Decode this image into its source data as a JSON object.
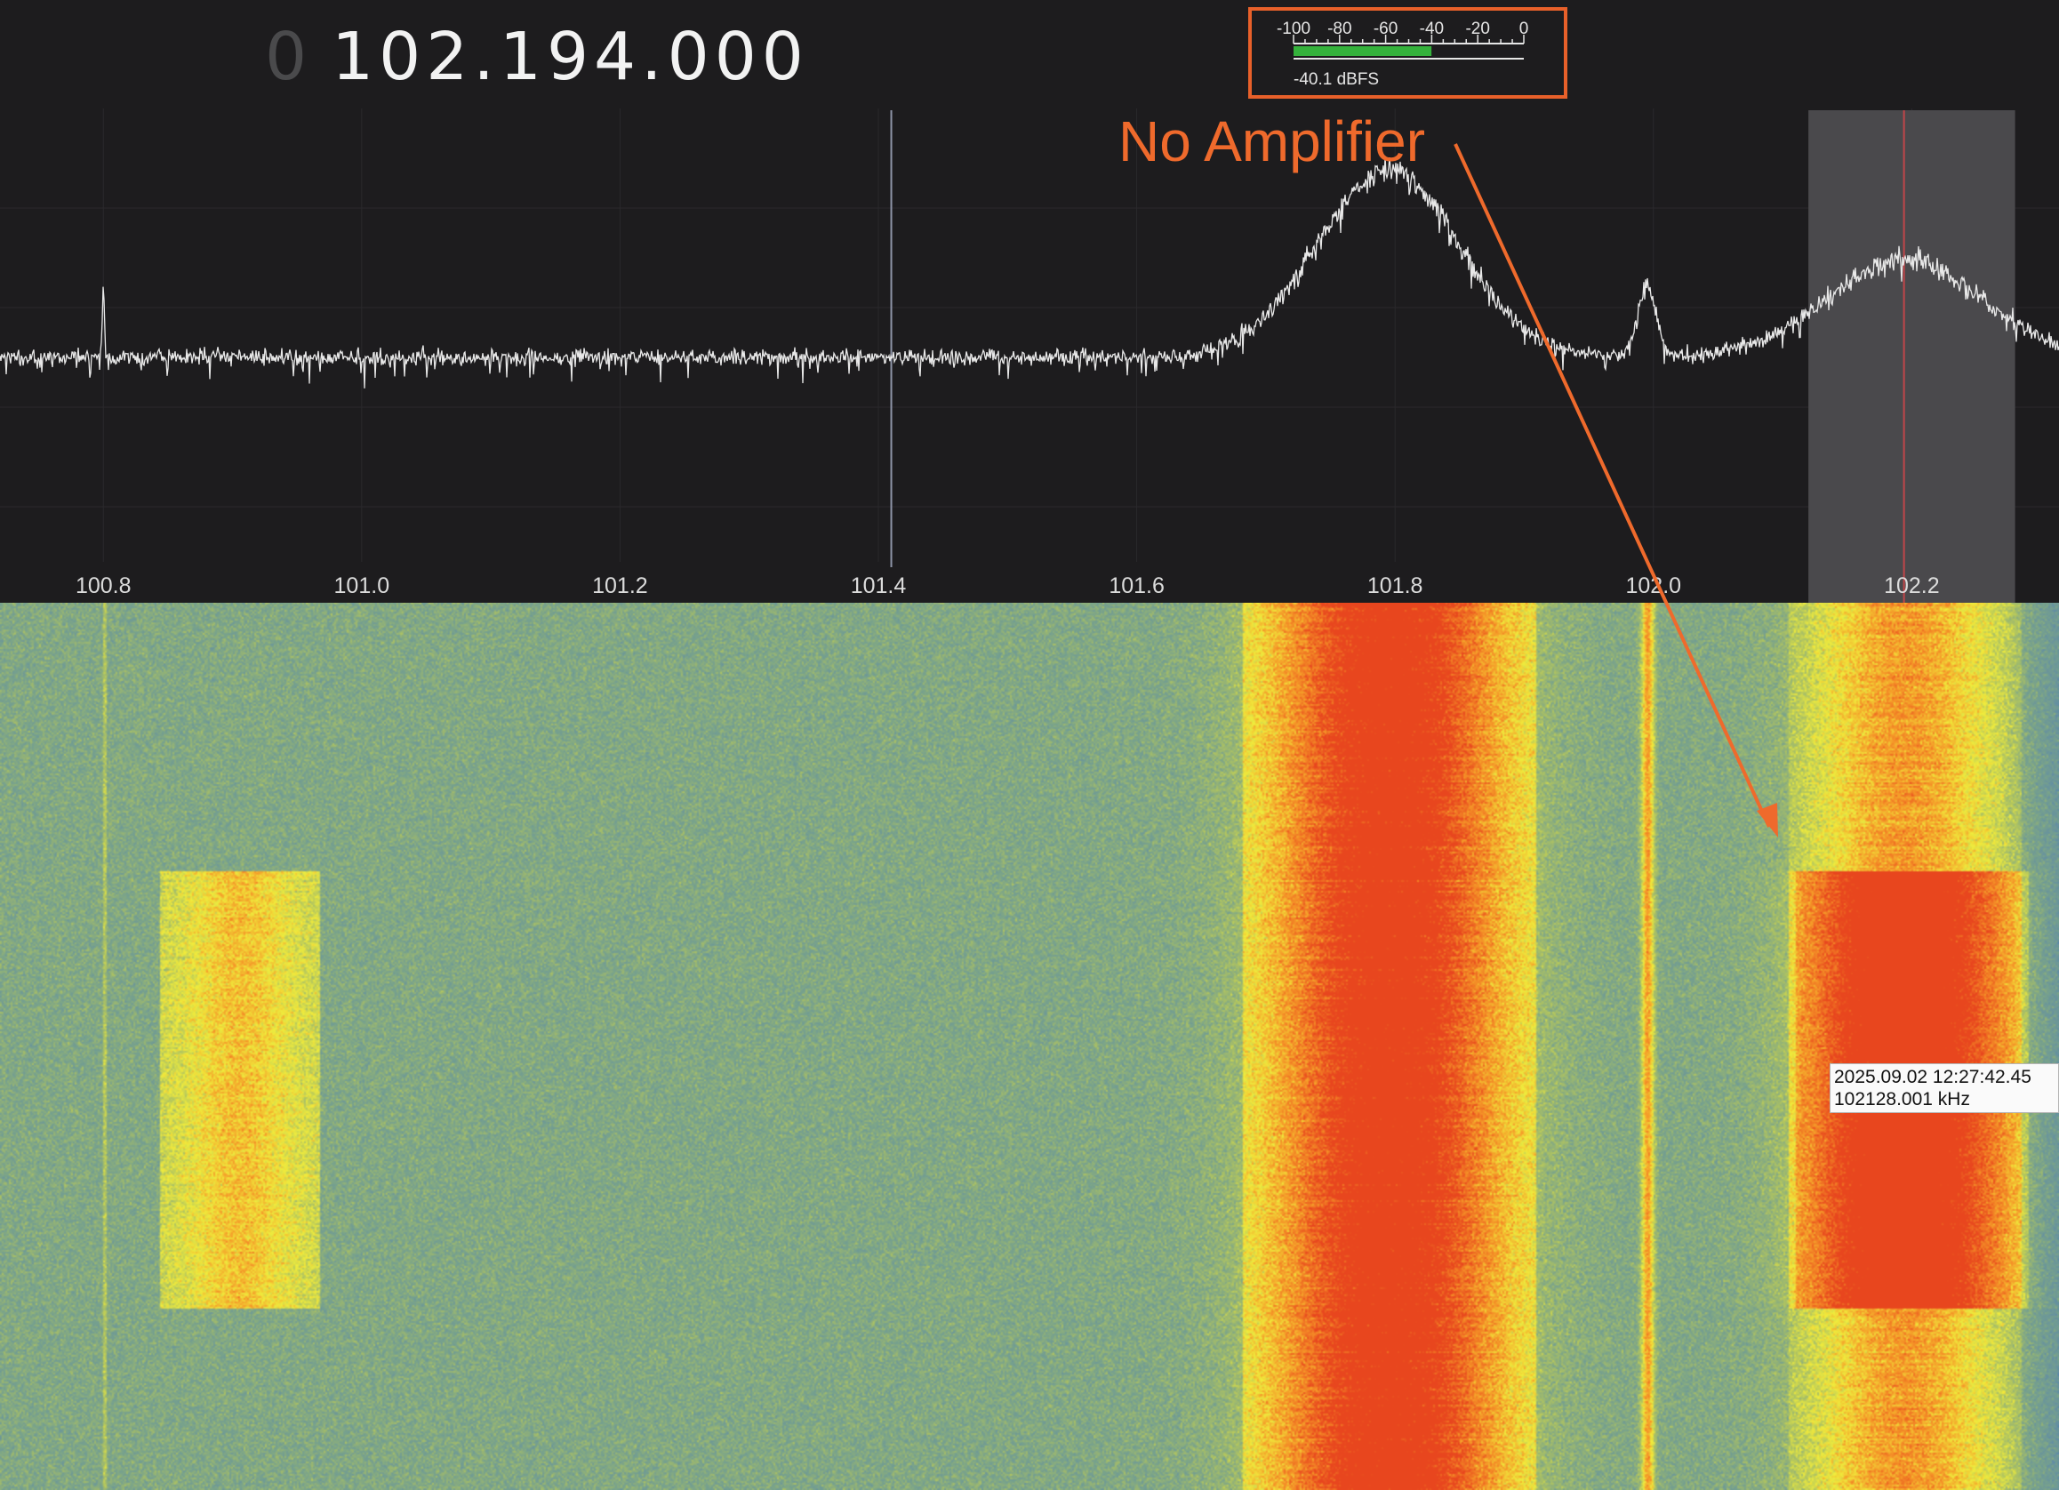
{
  "frequency": {
    "lead_digit": "0",
    "value": "102.194.000"
  },
  "level_meter": {
    "scale_labels": [
      "-100",
      "-80",
      "-60",
      "-40",
      "-20",
      "0"
    ],
    "scale_values": [
      -100,
      -80,
      -60,
      -40,
      -20,
      0
    ],
    "level_dbfs": -40.1,
    "readout": "-40.1 dBFS",
    "bar_color": "#35b23c"
  },
  "spectrum": {
    "axis": {
      "tick_labels": [
        "100.8",
        "101.0",
        "101.2",
        "101.4",
        "101.6",
        "101.8",
        "102.0",
        "102.2"
      ],
      "tick_values": [
        100.8,
        101.0,
        101.2,
        101.4,
        101.6,
        101.8,
        102.0,
        102.2
      ],
      "range": [
        100.72,
        102.314
      ]
    },
    "marker_frequency": 101.41,
    "passband": [
      102.12,
      102.28
    ],
    "tuned_frequency": 102.194,
    "signals": [
      {
        "center": 101.795,
        "strength": 1.0,
        "width": 0.055
      },
      {
        "center": 101.995,
        "strength": 0.38,
        "width": 0.007
      },
      {
        "center": 102.194,
        "strength": 0.52,
        "width": 0.06
      },
      {
        "center": 100.8,
        "strength": 0.4,
        "width": 0.0008
      }
    ]
  },
  "waterfall": {
    "tooltip": {
      "timestamp": "2025.09.02 12:27:42.45",
      "frequency": "102128.001 kHz"
    }
  },
  "annotation": {
    "label": "No Amplifier",
    "color": "#ef6a2c"
  }
}
